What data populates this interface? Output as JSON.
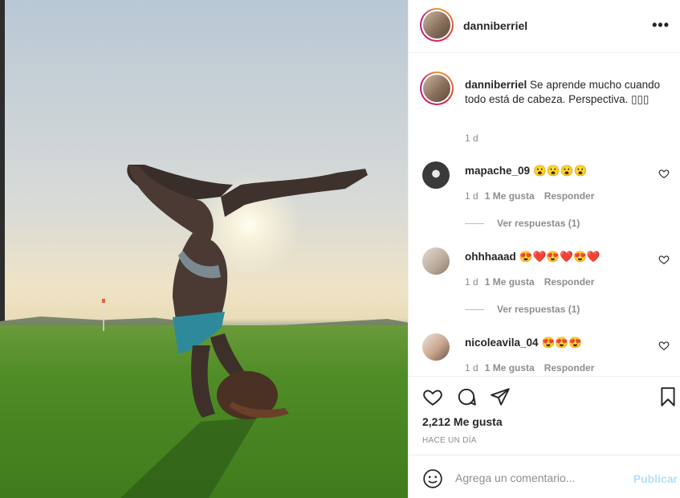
{
  "post": {
    "username": "danniberriel",
    "more_icon": "more-horizontal-icon"
  },
  "caption": {
    "username": "danniberriel",
    "text": "Se aprende mucho cuando todo está de cabeza. Perspectiva. ▯▯▯",
    "time": "1 d"
  },
  "comments": [
    {
      "username": "mapache_09",
      "text": "😮😮😮😮",
      "time": "1 d",
      "likes": "1 Me gusta",
      "reply": "Responder",
      "view_replies": "Ver respuestas (1)",
      "avatar_color": "#3a3a3a"
    },
    {
      "username": "ohhhaaad",
      "text": "😍❤️😍❤️😍❤️",
      "time": "1 d",
      "likes": "1 Me gusta",
      "reply": "Responder",
      "view_replies": "Ver respuestas (1)",
      "avatar_color": "#b9a999"
    },
    {
      "username": "nicoleavila_04",
      "text": "😍😍😍",
      "time": "1 d",
      "likes": "1 Me gusta",
      "reply": "Responder",
      "avatar_color": "#c8a58d"
    }
  ],
  "actions": {
    "like_icon": "heart-icon",
    "comment_icon": "comment-icon",
    "share_icon": "share-icon",
    "save_icon": "bookmark-icon",
    "likes": "2,212 Me gusta",
    "when": "HACE UN DÍA"
  },
  "compose": {
    "placeholder": "Agrega un comentario...",
    "post_label": "Publicar",
    "post_color": "#b2dffc"
  }
}
